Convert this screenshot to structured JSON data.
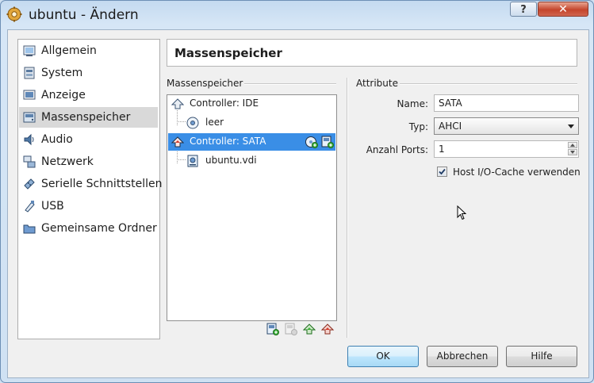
{
  "window": {
    "title": "ubuntu - Ändern",
    "help_glyph": "?",
    "close_glyph": "✕"
  },
  "nav": {
    "items": [
      {
        "label": "Allgemein",
        "icon": "general-settings-icon"
      },
      {
        "label": "System",
        "icon": "system-chip-icon"
      },
      {
        "label": "Anzeige",
        "icon": "display-icon"
      },
      {
        "label": "Massenspeicher",
        "icon": "storage-disk-icon",
        "selected": true
      },
      {
        "label": "Audio",
        "icon": "audio-speaker-icon"
      },
      {
        "label": "Netzwerk",
        "icon": "network-icon"
      },
      {
        "label": "Serielle Schnittstellen",
        "icon": "serial-port-icon"
      },
      {
        "label": "USB",
        "icon": "usb-icon"
      },
      {
        "label": "Gemeinsame Ordner",
        "icon": "shared-folder-icon"
      }
    ]
  },
  "page": {
    "title": "Massenspeicher"
  },
  "storage": {
    "group_label": "Massenspeicher",
    "tree": [
      {
        "label": "Controller: IDE",
        "type": "controller",
        "icon": "ide-controller-icon"
      },
      {
        "label": "leer",
        "type": "optical",
        "icon": "cd-drive-icon"
      },
      {
        "label": "Controller: SATA",
        "type": "controller",
        "icon": "sata-controller-icon",
        "selected": true
      },
      {
        "label": "ubuntu.vdi",
        "type": "disk",
        "icon": "hard-disk-icon"
      }
    ],
    "toolbar_icons": [
      "add-attachment-icon",
      "remove-attachment-icon",
      "add-controller-icon",
      "remove-controller-icon"
    ]
  },
  "attributes": {
    "group_label": "Attribute",
    "name_label": "Name:",
    "name_value": "SATA",
    "type_label": "Typ:",
    "type_value": "AHCI",
    "ports_label": "Anzahl Ports:",
    "ports_value": "1",
    "cache_label": "Host I/O-Cache verwenden",
    "cache_checked": true
  },
  "buttons": {
    "ok": "OK",
    "cancel": "Abbrechen",
    "help": "Hilfe"
  },
  "colors": {
    "selection": "#3a8ee6",
    "nav_selected": "#d9d9d9",
    "close_button": "#c4452c"
  }
}
